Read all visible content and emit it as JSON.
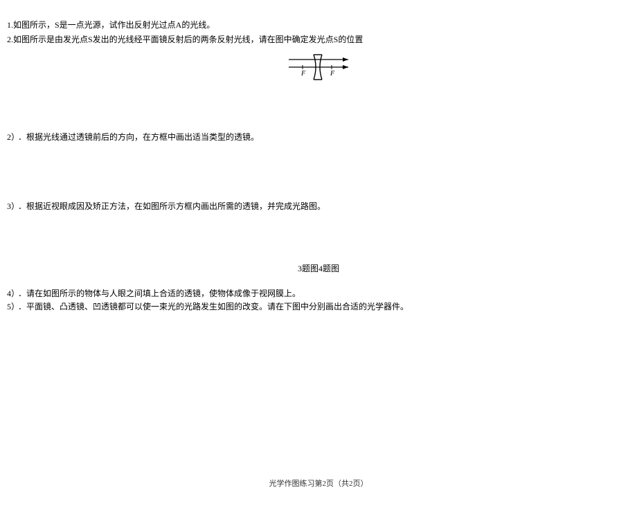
{
  "q1": "1.如图所示，S是一点光源，试作出反射光过点A的光线。",
  "q2": "2.如图所示是由发光点S发出的光线经平面镜反射后的两条反射光线，请在图中确定发光点S的位置",
  "lens_labels": {
    "left": "F",
    "right": "F"
  },
  "q2sub_num": "2）",
  "q2sub_text": "．根据光线通过透镜前后的方向，在方框中画出适当类型的透镜。",
  "q3sub_num": "3）",
  "q3sub_text": "．根据近视眼成因及矫正方法，在如图所示方框内画出所需的透镜，并完成光路图。",
  "fig_caption": "3题图4题图",
  "q4sub_num": "4）",
  "q4sub_text": "．请在如图所示的物体与人眼之间填上合适的透镜，使物体成像于视网膜上。",
  "q5sub_num": "5）",
  "q5sub_text": "．平面镜、凸透镜、凹透镜都可以使一束光的光路发生如图的改变。请在下图中分别画出合适的光学器件。",
  "footer": "光学作图练习第2页（共2页）"
}
